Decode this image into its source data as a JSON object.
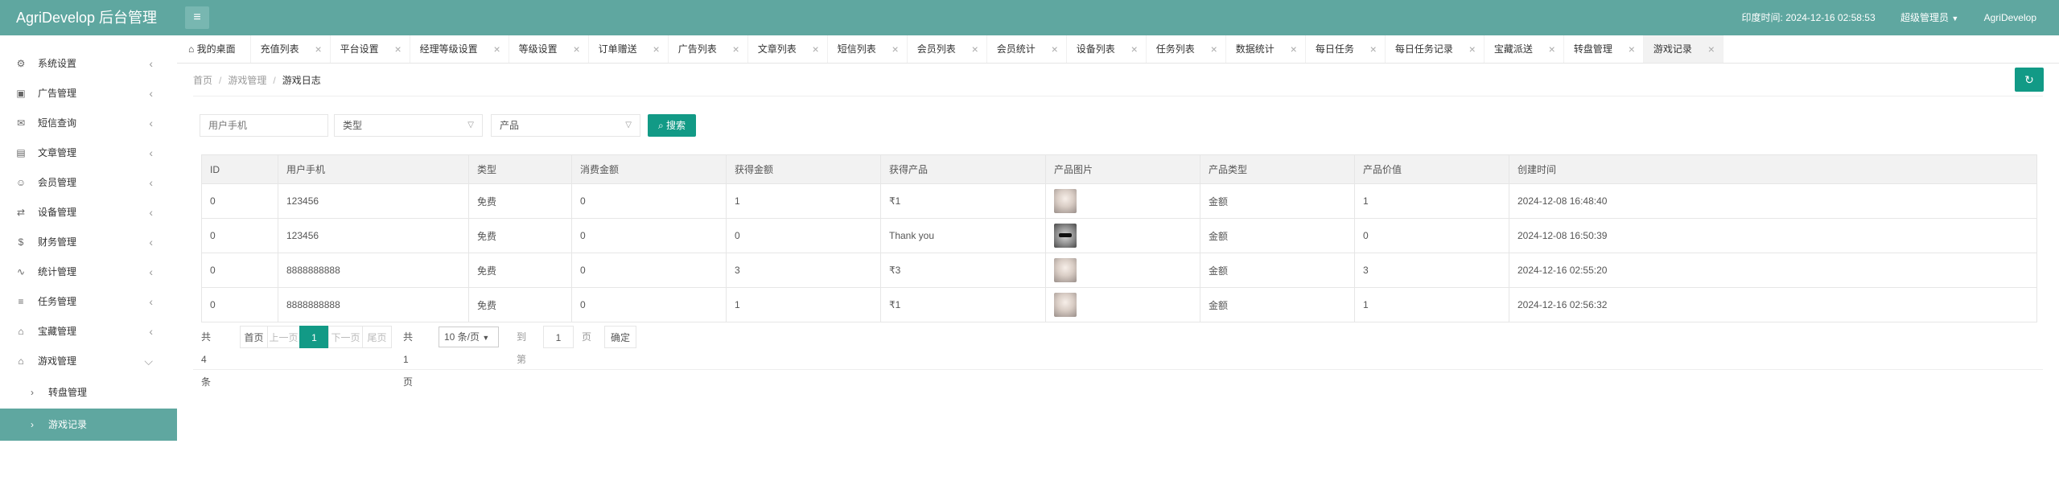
{
  "header": {
    "title": "AgriDevelop 后台管理",
    "menu_icon": "hamburger-icon",
    "india_time_label": "印度时间: 2024-12-16 02:58:53",
    "role": "超级管理员",
    "user": "AgriDevelop"
  },
  "sidebar": {
    "items": [
      {
        "label": "系统设置",
        "icon": "⚙"
      },
      {
        "label": "广告管理",
        "icon": "▣"
      },
      {
        "label": "短信查询",
        "icon": "✉"
      },
      {
        "label": "文章管理",
        "icon": "▤"
      },
      {
        "label": "会员管理",
        "icon": "☺"
      },
      {
        "label": "设备管理",
        "icon": "⇄"
      },
      {
        "label": "财务管理",
        "icon": "$"
      },
      {
        "label": "统计管理",
        "icon": "∿"
      },
      {
        "label": "任务管理",
        "icon": "≡"
      },
      {
        "label": "宝藏管理",
        "icon": "⌂"
      },
      {
        "label": "游戏管理",
        "icon": "⌂"
      }
    ],
    "sub_items": [
      {
        "label": "转盘管理"
      },
      {
        "label": "游戏记录"
      }
    ]
  },
  "tabs": {
    "home": "我的桌面",
    "items": [
      "充值列表",
      "平台设置",
      "经理等级设置",
      "等级设置",
      "订单赠送",
      "广告列表",
      "文章列表",
      "短信列表",
      "会员列表",
      "会员统计",
      "设备列表",
      "任务列表",
      "数据统计",
      "每日任务",
      "每日任务记录",
      "宝藏派送",
      "转盘管理",
      "游戏记录"
    ]
  },
  "breadcrumb": {
    "home": "首页",
    "parent": "游戏管理",
    "current": "游戏日志"
  },
  "filters": {
    "phone_placeholder": "用户手机",
    "type_placeholder": "类型",
    "product_placeholder": "产品",
    "search_label": "搜索"
  },
  "table": {
    "columns": [
      "ID",
      "用户手机",
      "类型",
      "消费金额",
      "获得金额",
      "获得产品",
      "产品图片",
      "产品类型",
      "产品价值",
      "创建时间"
    ],
    "rows": [
      {
        "id": "0",
        "phone": "123456",
        "type": "免费",
        "cost": "0",
        "gain": "1",
        "product": "₹1",
        "image": "cat",
        "ptype": "金额",
        "value": "1",
        "created": "2024-12-08 16:48:40"
      },
      {
        "id": "0",
        "phone": "123456",
        "type": "免费",
        "cost": "0",
        "gain": "0",
        "product": "Thank you",
        "image": "shades",
        "ptype": "金额",
        "value": "0",
        "created": "2024-12-08 16:50:39"
      },
      {
        "id": "0",
        "phone": "8888888888",
        "type": "免费",
        "cost": "0",
        "gain": "3",
        "product": "₹3",
        "image": "cat",
        "ptype": "金额",
        "value": "3",
        "created": "2024-12-16 02:55:20"
      },
      {
        "id": "0",
        "phone": "8888888888",
        "type": "免费",
        "cost": "0",
        "gain": "1",
        "product": "₹1",
        "image": "cat",
        "ptype": "金额",
        "value": "1",
        "created": "2024-12-16 02:56:32"
      }
    ]
  },
  "pagination": {
    "total": "共 4 条",
    "first": "首页",
    "prev": "上一页",
    "current": "1",
    "next": "下一页",
    "last": "尾页",
    "pages": "共 1 页",
    "per_page": "10 条/页",
    "goto_label": "到第",
    "goto_value": "1",
    "page_unit": "页",
    "confirm": "确定"
  },
  "colors": {
    "header": "#5fa7a0",
    "accent": "#129a86",
    "free_type": "#5fb878"
  }
}
